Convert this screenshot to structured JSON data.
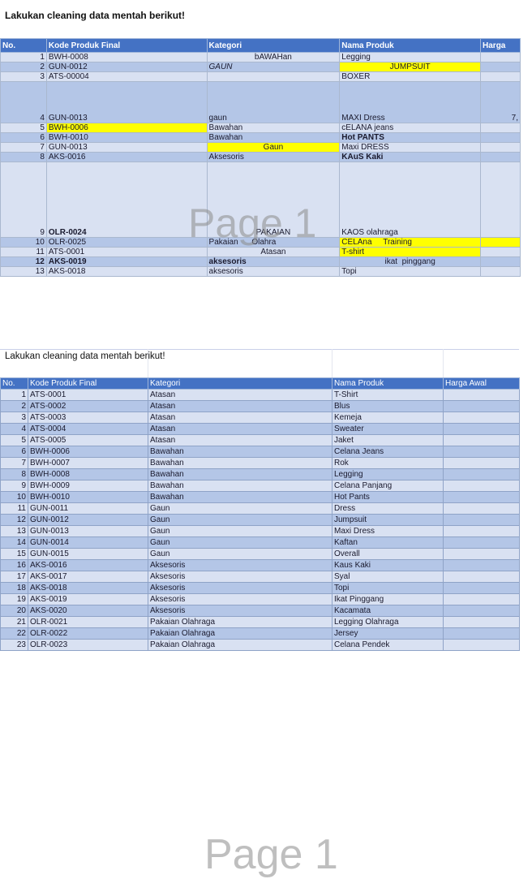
{
  "top_sheet": {
    "title": "Lakukan cleaning data mentah berikut!",
    "headers": [
      "No.",
      "Kode Produk Final",
      "Kategori",
      "Nama Produk",
      "Harga"
    ],
    "watermark": "Page 1",
    "rows": [
      {
        "no": "1",
        "kode": "BWH-0008",
        "kategori": "bAWAHan",
        "nama": "Legging",
        "harga": ""
      },
      {
        "no": "2",
        "kode": "GUN-0012",
        "kategori": "GAUN",
        "nama": "JUMPSUIT",
        "harga": ""
      },
      {
        "no": "3",
        "kode": "ATS-00004",
        "kategori": "",
        "nama": "BOXER",
        "harga": ""
      },
      {
        "no": "4",
        "kode": "GUN-0013",
        "kategori": "gaun",
        "nama": "MAXI Dress",
        "harga": "7,"
      },
      {
        "no": "5",
        "kode": "BWH-0006",
        "kategori": "Bawahan",
        "nama": "cELANA jeans",
        "harga": ""
      },
      {
        "no": "6",
        "kode": "BWH-0010",
        "kategori": "Bawahan",
        "nama": "Hot  PANTS",
        "harga": ""
      },
      {
        "no": "7",
        "kode": "GUN-0013",
        "kategori": "Gaun",
        "nama": "Maxi DRESS",
        "harga": ""
      },
      {
        "no": "8",
        "kode": "AKS-0016",
        "kategori": "Aksesoris",
        "nama": "KAuS Kaki",
        "harga": ""
      },
      {
        "no": "9",
        "kode": "OLR-0024",
        "kategori": "PAKAIAN",
        "nama": "KAOS olahraga",
        "harga": ""
      },
      {
        "no": "10",
        "kode": "OLR-0025",
        "kategori": "Pakaian      Olahra",
        "nama": "CELAna     Training",
        "harga": ""
      },
      {
        "no": "11",
        "kode": "ATS-0001",
        "kategori": "Atasan",
        "nama": "T-shirt",
        "harga": ""
      },
      {
        "no": "12",
        "kode": "AKS-0019",
        "kategori": "aksesoris",
        "nama": "ikat  pinggang",
        "harga": ""
      },
      {
        "no": "13",
        "kode": "AKS-0018",
        "kategori": "aksesoris",
        "nama": "Topi",
        "harga": ""
      }
    ]
  },
  "bottom_sheet": {
    "title": "Lakukan cleaning data mentah berikut!",
    "headers": [
      "No.",
      "Kode Produk Final",
      "Kategori",
      "Nama Produk",
      "Harga Awal"
    ],
    "watermark": "Page 1",
    "rows": [
      {
        "no": "1",
        "kode": "ATS-0001",
        "kategori": "Atasan",
        "nama": "T-Shirt"
      },
      {
        "no": "2",
        "kode": "ATS-0002",
        "kategori": "Atasan",
        "nama": "Blus"
      },
      {
        "no": "3",
        "kode": "ATS-0003",
        "kategori": "Atasan",
        "nama": "Kemeja"
      },
      {
        "no": "4",
        "kode": "ATS-0004",
        "kategori": "Atasan",
        "nama": "Sweater"
      },
      {
        "no": "5",
        "kode": "ATS-0005",
        "kategori": "Atasan",
        "nama": "Jaket"
      },
      {
        "no": "6",
        "kode": "BWH-0006",
        "kategori": "Bawahan",
        "nama": "Celana Jeans"
      },
      {
        "no": "7",
        "kode": "BWH-0007",
        "kategori": "Bawahan",
        "nama": "Rok"
      },
      {
        "no": "8",
        "kode": "BWH-0008",
        "kategori": "Bawahan",
        "nama": "Legging"
      },
      {
        "no": "9",
        "kode": "BWH-0009",
        "kategori": "Bawahan",
        "nama": "Celana Panjang"
      },
      {
        "no": "10",
        "kode": "BWH-0010",
        "kategori": "Bawahan",
        "nama": "Hot Pants"
      },
      {
        "no": "11",
        "kode": "GUN-0011",
        "kategori": "Gaun",
        "nama": "Dress"
      },
      {
        "no": "12",
        "kode": "GUN-0012",
        "kategori": "Gaun",
        "nama": "Jumpsuit"
      },
      {
        "no": "13",
        "kode": "GUN-0013",
        "kategori": "Gaun",
        "nama": "Maxi Dress"
      },
      {
        "no": "14",
        "kode": "GUN-0014",
        "kategori": "Gaun",
        "nama": "Kaftan"
      },
      {
        "no": "15",
        "kode": "GUN-0015",
        "kategori": "Gaun",
        "nama": "Overall"
      },
      {
        "no": "16",
        "kode": "AKS-0016",
        "kategori": "Aksesoris",
        "nama": "Kaus Kaki"
      },
      {
        "no": "17",
        "kode": "AKS-0017",
        "kategori": "Aksesoris",
        "nama": "Syal"
      },
      {
        "no": "18",
        "kode": "AKS-0018",
        "kategori": "Aksesoris",
        "nama": "Topi"
      },
      {
        "no": "19",
        "kode": "AKS-0019",
        "kategori": "Aksesoris",
        "nama": "Ikat Pinggang"
      },
      {
        "no": "20",
        "kode": "AKS-0020",
        "kategori": "Aksesoris",
        "nama": "Kacamata"
      },
      {
        "no": "21",
        "kode": "OLR-0021",
        "kategori": "Pakaian Olahraga",
        "nama": "Legging Olahraga"
      },
      {
        "no": "22",
        "kode": "OLR-0022",
        "kategori": "Pakaian Olahraga",
        "nama": "Jersey"
      },
      {
        "no": "23",
        "kode": "OLR-0023",
        "kategori": "Pakaian Olahraga",
        "nama": "Celana Pendek"
      }
    ]
  },
  "colors": {
    "header_blue": "#4472c4",
    "row_light": "#d9e1f2",
    "row_dark": "#b4c6e7",
    "highlight_yellow": "#ffff00"
  }
}
